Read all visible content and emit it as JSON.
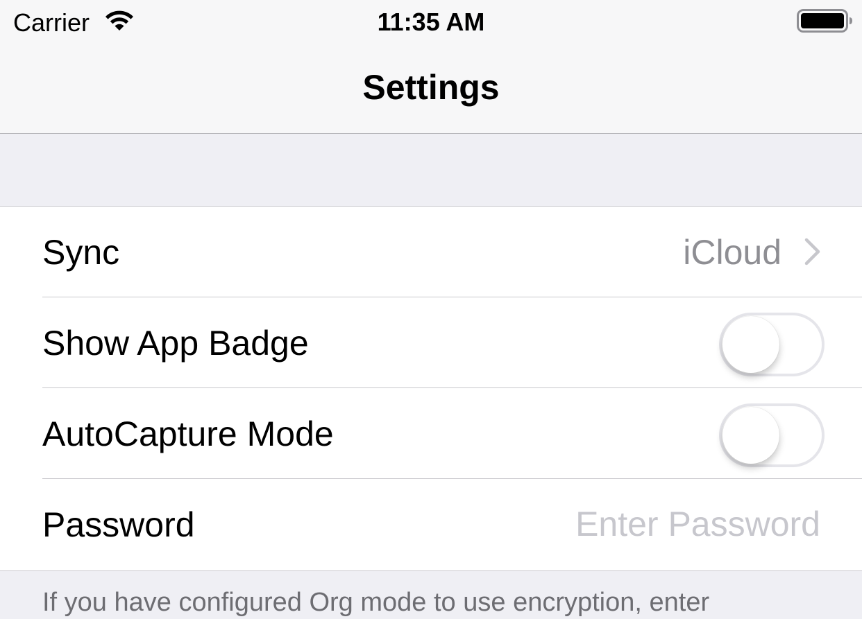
{
  "status_bar": {
    "carrier": "Carrier",
    "time": "11:35 AM",
    "wifi_icon": "wifi-icon",
    "battery_icon": "battery-full-icon"
  },
  "nav": {
    "title": "Settings"
  },
  "rows": [
    {
      "label": "Sync",
      "value": "iCloud",
      "accessory": "chevron-right-icon"
    },
    {
      "label": "Show App Badge",
      "toggle_on": false
    },
    {
      "label": "AutoCapture Mode",
      "toggle_on": false
    },
    {
      "label": "Password",
      "placeholder": "Enter Password",
      "value": ""
    }
  ],
  "footer": {
    "text": "If you have configured Org mode to use encryption, enter"
  },
  "colors": {
    "background": "#efeff4",
    "cell": "#ffffff",
    "separator": "#c8c7cc",
    "secondary_text": "#8e8e93",
    "placeholder": "#c7c7cd",
    "switch_off_border": "#e5e5ea"
  }
}
